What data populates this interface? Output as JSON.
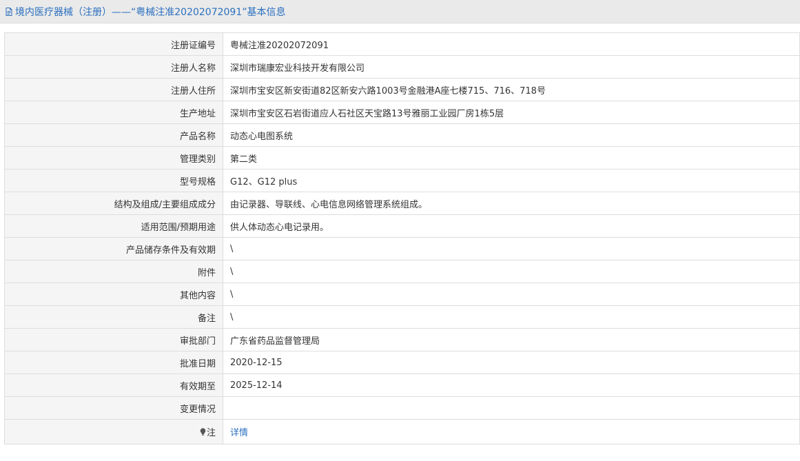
{
  "header": {
    "title": "境内医疗器械（注册）——“粤械注准20202072091”基本信息",
    "icon": "document-icon",
    "color": "#2a6fbf"
  },
  "rows": [
    {
      "label": "注册证编号",
      "value": "粤械注准20202072091"
    },
    {
      "label": "注册人名称",
      "value": "深圳市瑞康宏业科技开发有限公司"
    },
    {
      "label": "注册人住所",
      "value": "深圳市宝安区新安街道82区新安六路1003号金融港A座七楼715、716、718号"
    },
    {
      "label": "生产地址",
      "value": "深圳市宝安区石岩街道应人石社区天宝路13号雅丽工业园厂房1栋5层"
    },
    {
      "label": "产品名称",
      "value": "动态心电图系统"
    },
    {
      "label": "管理类别",
      "value": "第二类"
    },
    {
      "label": "型号规格",
      "value": "G12、G12 plus"
    },
    {
      "label": "结构及组成/主要组成成分",
      "value": "由记录器、导联线、心电信息网络管理系统组成。"
    },
    {
      "label": "适用范围/预期用途",
      "value": "供人体动态心电记录用。"
    },
    {
      "label": "产品储存条件及有效期",
      "value": "\\"
    },
    {
      "label": "附件",
      "value": "\\"
    },
    {
      "label": "其他内容",
      "value": "\\"
    },
    {
      "label": "备注",
      "value": "\\"
    },
    {
      "label": "审批部门",
      "value": "广东省药品监督管理局"
    },
    {
      "label": "批准日期",
      "value": "2020-12-15"
    },
    {
      "label": "有效期至",
      "value": "2025-12-14"
    },
    {
      "label": "变更情况",
      "value": ""
    }
  ],
  "note_row": {
    "label": "注",
    "icon": "lightbulb-icon",
    "link_text": "详情"
  },
  "colors": {
    "label_bg": "#f5f5f5",
    "border": "#dddddd",
    "link": "#2a6fbf"
  }
}
